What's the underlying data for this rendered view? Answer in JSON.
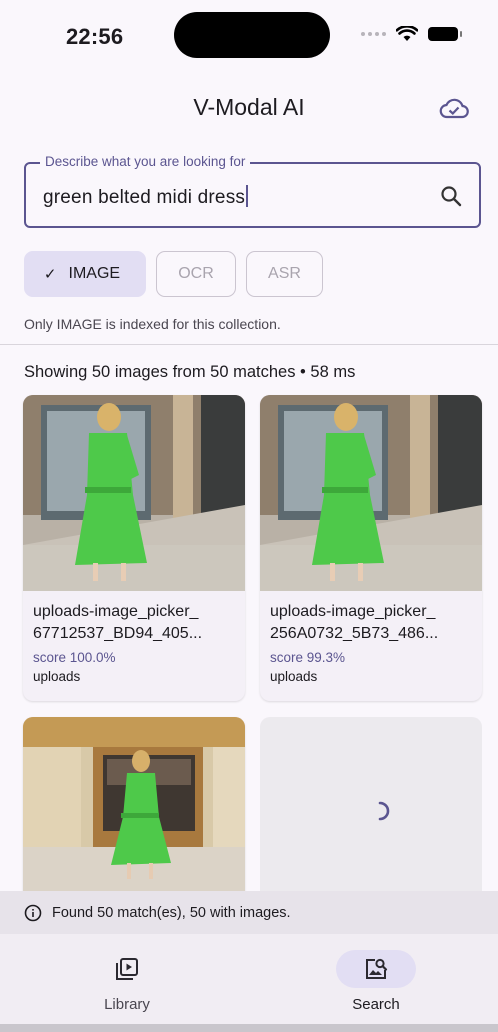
{
  "status_bar": {
    "time": "22:56"
  },
  "app": {
    "title": "V-Modal AI"
  },
  "search": {
    "legend": "Describe what you are looking for",
    "value": "green belted midi dress"
  },
  "chips": [
    {
      "label": "IMAGE",
      "selected": true
    },
    {
      "label": "OCR",
      "selected": false
    },
    {
      "label": "ASR",
      "selected": false
    }
  ],
  "index_note": "Only IMAGE is indexed for this collection.",
  "results_summary": "Showing 50 images from 50 matches • 58 ms",
  "results": [
    {
      "filename": "uploads-image_picker_\n67712537_BD94_405...",
      "score": "score 100.0%",
      "source": "uploads"
    },
    {
      "filename": "uploads-image_picker_\n256A0732_5B73_486...",
      "score": "score 99.3%",
      "source": "uploads"
    }
  ],
  "snackbar": {
    "message": "Found 50 match(es), 50 with images."
  },
  "bottom_nav": [
    {
      "label": "Library",
      "icon": "video-library-icon",
      "active": false
    },
    {
      "label": "Search",
      "icon": "image-search-icon",
      "active": true
    }
  ],
  "colors": {
    "accent": "#5b5590",
    "chip_selected": "#e2def3",
    "dress_green": "#4ec94a"
  }
}
